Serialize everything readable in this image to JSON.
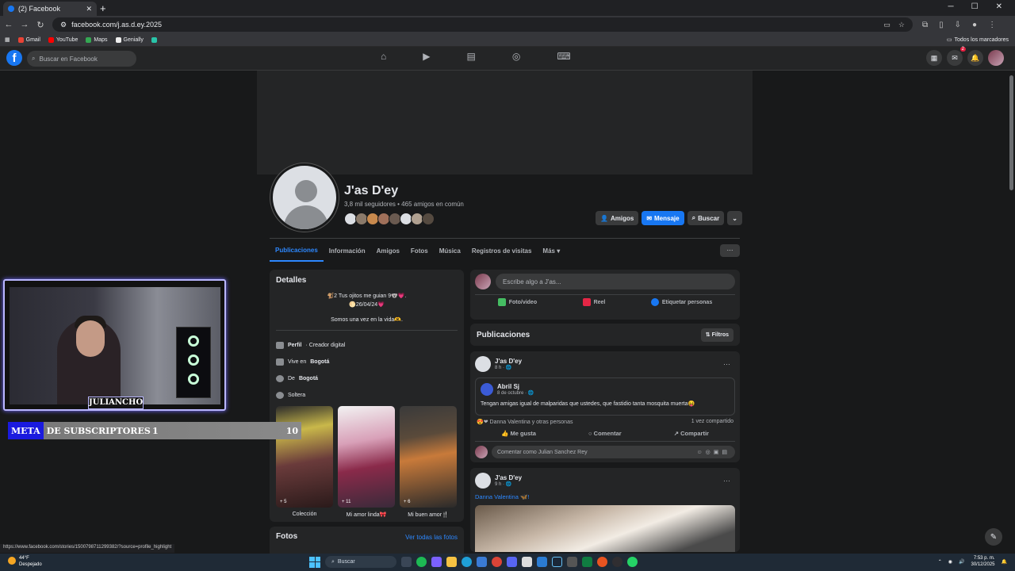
{
  "browser": {
    "tab_title": "(2) Facebook",
    "url": "facebook.com/j.as.d.ey.2025",
    "bookmarks": [
      "Gmail",
      "YouTube",
      "Maps",
      "Genially"
    ],
    "all_bookmarks": "Todos los marcadores",
    "status_url": "https://www.facebook.com/stories/1500798711299382/?source=profile_highlight"
  },
  "fb": {
    "search_placeholder": "Buscar en Facebook",
    "messenger_badge": "2"
  },
  "profile": {
    "name": "J'as D'ey",
    "meta": "3,8 mil seguidores • 465 amigos en común",
    "buttons": {
      "friends": "Amigos",
      "message": "Mensaje",
      "search": "Buscar"
    },
    "tabs": [
      "Publicaciones",
      "Información",
      "Amigos",
      "Fotos",
      "Música",
      "Registros de visitas",
      "Más ▾"
    ]
  },
  "details": {
    "title": "Detalles",
    "bio_line1": "🐒2 Tus ojitos me guian 9🐨💗.",
    "bio_line2": "🌕26/04/24💗",
    "bio_line3": "Somos una vez en la vida🫶.",
    "rows": [
      {
        "label": "Perfil",
        "value": " · Creador digital"
      },
      {
        "label": "Vive en ",
        "value": "Bogotá"
      },
      {
        "label": "De ",
        "value": "Bogotá"
      },
      {
        "label": "Soltera",
        "value": ""
      }
    ],
    "highlights": [
      {
        "count": "+ 5",
        "label": "Colección"
      },
      {
        "count": "+ 11",
        "label": "Mi amor linda🎀"
      },
      {
        "count": "+ 6",
        "label": "Mi buen amor🍴"
      }
    ]
  },
  "photos": {
    "title": "Fotos",
    "link": "Ver todas las fotos"
  },
  "composer": {
    "placeholder": "Escribe algo a J'as...",
    "actions": [
      "Foto/video",
      "Reel",
      "Etiquetar personas"
    ]
  },
  "publications": {
    "title": "Publicaciones",
    "filter": "Filtros"
  },
  "post1": {
    "author": "J'as D'ey",
    "time": "8 h · 🌐",
    "shared_author": "Abril Sj",
    "shared_time": "8 de octubre · 🌐",
    "shared_text": "Tengan amigas igual de malparidas que ustedes, que fastidio tanta mosquita muerta😝",
    "reactions": "Danna Valentina y otras personas",
    "shares": "1 vez compartido",
    "like": "Me gusta",
    "comment": "Comentar",
    "share": "Compartir",
    "comment_placeholder": "Comentar como Julian Sanchez Rey"
  },
  "post2": {
    "author": "J'as D'ey",
    "time": "9 h · 🌐",
    "mention": "Danna Valentina 🦋!"
  },
  "overlay": {
    "streamer": "JULIANCHO",
    "goal_word1": "META",
    "goal_word2": "DE SUBSCRIPTORES",
    "current": "1",
    "target": "10",
    "progress_fraction": 0.1
  },
  "taskbar": {
    "temp": "44°F",
    "weather": "Despejado",
    "search": "Buscar",
    "time": "7:53 p. m.",
    "date": "30/12/2025"
  },
  "colors": {
    "facebook_blue": "#1877f2",
    "link_blue": "#2d88ff",
    "overlay_accent": "#b9b6ff"
  }
}
